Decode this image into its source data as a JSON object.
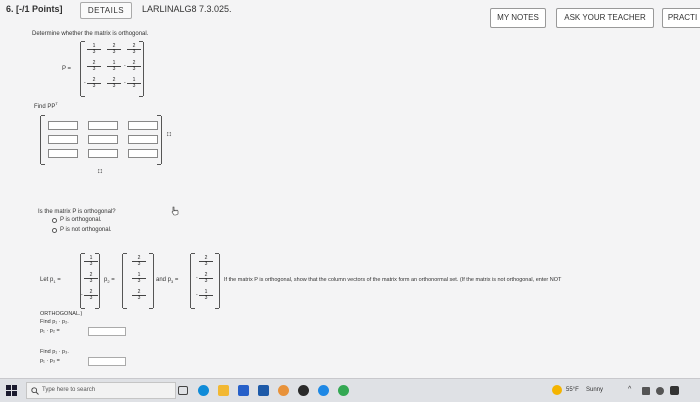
{
  "header": {
    "question_number": "6. [-/1 Points]",
    "details_label": "DETAILS",
    "question_title": "LARLINALG8 7.3.025.",
    "my_notes_label": "MY NOTES",
    "ask_teacher_label": "ASK YOUR TEACHER",
    "practice_label": "PRACTI"
  },
  "problem": {
    "instruction": "Determine whether the matrix is orthogonal.",
    "matrix_label": "P =",
    "find_label": "Find PP",
    "find_superscript": "T",
    "matrix": {
      "rows": [
        [
          {
            "sign": "",
            "n": "1",
            "d": "3"
          },
          {
            "sign": "",
            "n": "2",
            "d": "3"
          },
          {
            "sign": "",
            "n": "2",
            "d": "3"
          }
        ],
        [
          {
            "sign": "",
            "n": "2",
            "d": "3"
          },
          {
            "sign": "",
            "n": "1",
            "d": "3"
          },
          {
            "sign": "-",
            "n": "2",
            "d": "3"
          }
        ],
        [
          {
            "sign": "-",
            "n": "2",
            "d": "3"
          },
          {
            "sign": "",
            "n": "2",
            "d": "3"
          },
          {
            "sign": "-",
            "n": "1",
            "d": "3"
          }
        ]
      ]
    },
    "adjust_marks": "↕↕",
    "resize_marks": "↕↕"
  },
  "orthogonal_question": {
    "prompt": "Is the matrix P is orthogonal?",
    "options": [
      "P is orthogonal.",
      "P is not orthogonal."
    ]
  },
  "column_vectors": {
    "let_label": "Let p",
    "p2_label": "p",
    "and_label": "and p",
    "equals": "=",
    "subscripts": [
      "1",
      "2",
      "3"
    ],
    "p1": [
      {
        "sign": "",
        "n": "1",
        "d": "3"
      },
      {
        "sign": "",
        "n": "2",
        "d": "3"
      },
      {
        "sign": "-",
        "n": "2",
        "d": "3"
      }
    ],
    "p2": [
      {
        "sign": "",
        "n": "2",
        "d": "3"
      },
      {
        "sign": "",
        "n": "1",
        "d": "3"
      },
      {
        "sign": "",
        "n": "2",
        "d": "3"
      }
    ],
    "p3": [
      {
        "sign": "",
        "n": "2",
        "d": "3"
      },
      {
        "sign": "-",
        "n": "2",
        "d": "3"
      },
      {
        "sign": "-",
        "n": "1",
        "d": "3"
      }
    ],
    "instruction_text": "If the matrix P is orthogonal, show that the column vectors of the matrix form an orthonormal set. (If the matrix is not orthogonal, enter NOT",
    "orthogonal_tag": "ORTHOGONAL.)",
    "find_p1p2": "Find p₁ · p₂.",
    "eq_p1p2": "p₁ · p₂ =",
    "find_p1p3": "Find p₁ · p₃.",
    "eq_p1p3": "p₁ · p₃ ="
  },
  "taskbar": {
    "search_placeholder": "Type here to search",
    "weather_temp": "55°F",
    "weather_desc": "Sunny",
    "colors": {
      "accent": "#1a73e8",
      "taskbar_bg": "#dfe1e5"
    }
  }
}
